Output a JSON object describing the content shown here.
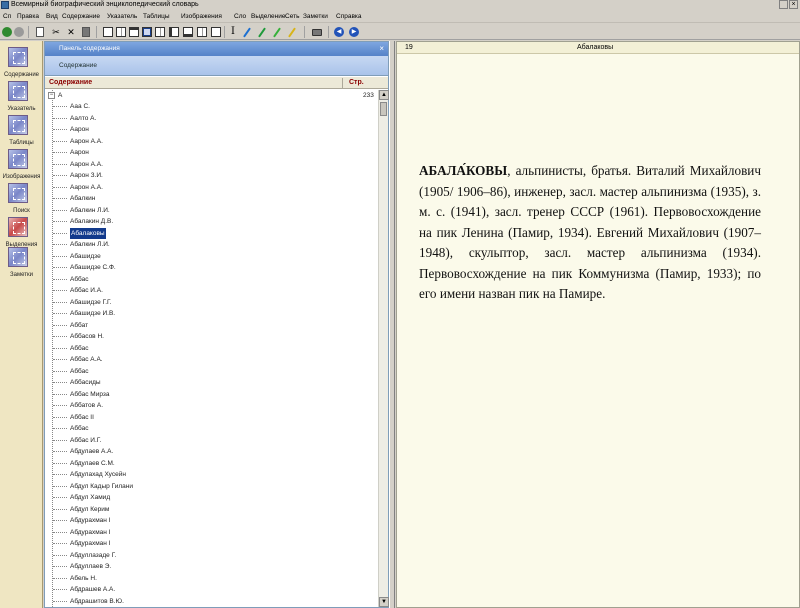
{
  "window": {
    "title": "Всемирный биографический энциклопедический словарь",
    "close_glyph": "×"
  },
  "menu": [
    "Сп",
    "Правка",
    "Вид",
    "Содержание",
    "Указатель",
    "Таблицы",
    "Изображения",
    "Сло",
    "Выделение",
    "Сеть",
    "Заметки",
    "Справка"
  ],
  "toolbar": {
    "back_glyph": "◀",
    "forward_glyph": "▶",
    "colors": {
      "back": "#2f8a2f",
      "forward": "#2f8a2f",
      "nav_left": "#2253b8",
      "nav_right": "#2253b8",
      "pen_blue": "#1b6fd1",
      "pen_green": "#1f9a3a",
      "pen_lime": "#36b13a",
      "pen_yellow": "#d8b418"
    }
  },
  "sidebar": {
    "items": [
      {
        "label": "Содержание",
        "icon": "contents-icon"
      },
      {
        "label": "Указатель",
        "icon": "index-icon"
      },
      {
        "label": "Таблицы",
        "icon": "tables-icon"
      },
      {
        "label": "Изображения",
        "icon": "images-icon"
      },
      {
        "label": "Поиск",
        "icon": "search-icon"
      },
      {
        "label": "Выделения",
        "icon": "highlights-icon"
      },
      {
        "label": "Заметки",
        "icon": "notes-icon"
      }
    ]
  },
  "nav_panel": {
    "title": "Панель содержания",
    "close_glyph": "×",
    "subtitle": "Содержание",
    "col_title": "Содержание",
    "col_page": "Стр.",
    "root": {
      "label": "А",
      "expander": "−",
      "page": "233"
    },
    "selected_label": "Абалаковы",
    "entries": [
      "Ааа С.",
      "Аалто А.",
      "Аарон",
      "Аарон А.А.",
      "Аарон",
      "Аарон А.А.",
      "Аарон З.И.",
      "Аарон А.А.",
      "Абалкин",
      "Абалкин Л.И.",
      "Абалакин Д.В.",
      "Абалаковы",
      "Абалкин Л.И.",
      "Абашидзе",
      "Абашидзе С.Ф.",
      "Аббас",
      "Аббас И.А.",
      "Абашидзе Г.Г.",
      "Абашидзе И.В.",
      "Аббат",
      "Аббасов Н.",
      "Аббас",
      "Аббас А.А.",
      "Аббас",
      "Аббасиды",
      "Аббас Мирза",
      "Аббатов А.",
      "Аббас II",
      "Аббас",
      "Аббас И.Г.",
      "Абдулаев А.А.",
      "Абдулаев С.М.",
      "Абдулахад Хусейн",
      "Абдул Кадыр Гилани",
      "Абдул Хамид",
      "Абдул Керим",
      "Абдурахман I",
      "Абдурахман I",
      "Абдурахман I",
      "Абдуллазаде Г.",
      "Абдуллаев Э.",
      "Абель Н.",
      "Абдрашев А.А.",
      "Абдрашитов В.Ю.",
      "Абдрашитов В.Ю."
    ]
  },
  "article": {
    "page": "19",
    "title": "Абалаковы",
    "headword": "АБАЛА́КОВЫ",
    "text": ", альпинисты, братья. Виталий Михайлович (1905/ 1906–86), инженер, засл. мастер альпинизма (1935), з. м. с. (1941), засл. тренер СССР (1961). Первовосхождение на пик Ленина (Памир, 1934). Евгений Михайлович (1907–1948), скульптор, засл. мастер альпинизма (1934). Первовосхождение на пик Коммунизма (Памир, 1933); по его имени назван пик на Памире."
  }
}
